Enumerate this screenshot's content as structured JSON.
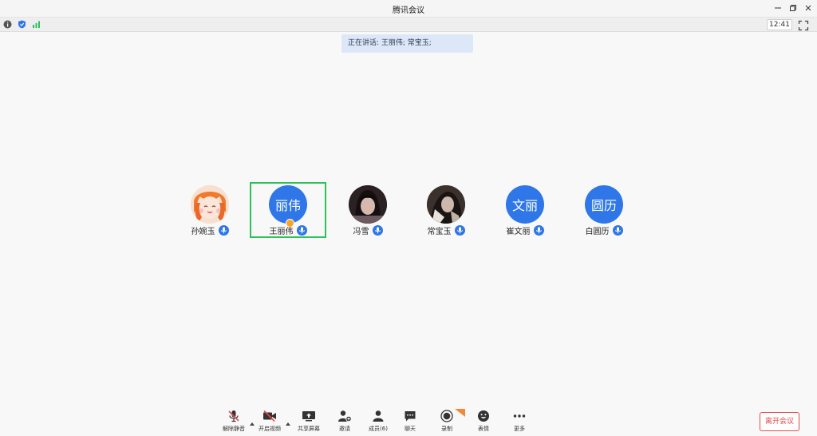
{
  "window": {
    "title": "腾讯会议"
  },
  "status_bar": {
    "clock": "12:41",
    "icons": [
      "info-icon",
      "shield-icon",
      "signal-icon"
    ]
  },
  "speaking_banner": {
    "text": "正在讲话: 王丽伟; 常宝玉;"
  },
  "participants": [
    {
      "name": "孙婉玉",
      "avatar_type": "photo",
      "avatar_text": "",
      "mic": "on"
    },
    {
      "name": "王丽伟",
      "avatar_type": "text",
      "avatar_text": "丽伟",
      "mic": "on",
      "active": true,
      "host": true
    },
    {
      "name": "冯雪",
      "avatar_type": "photo",
      "avatar_text": "",
      "mic": "on"
    },
    {
      "name": "常宝玉",
      "avatar_type": "photo",
      "avatar_text": "",
      "mic": "on"
    },
    {
      "name": "崔文丽",
      "avatar_type": "text",
      "avatar_text": "文丽",
      "mic": "on"
    },
    {
      "name": "白圆历",
      "avatar_type": "text",
      "avatar_text": "圆历",
      "mic": "on"
    }
  ],
  "toolbar": {
    "unmute": "解除静音",
    "start_video": "开启视频",
    "share_screen": "共享屏幕",
    "invite": "邀请",
    "members": "成员(6)",
    "chat": "聊天",
    "record": "录制",
    "reactions": "表情",
    "more": "更多",
    "leave": "离开会议"
  },
  "colors": {
    "accent": "#2f76e8",
    "active_border": "#2fc05a",
    "leave": "#e24b4b",
    "banner_bg": "#dce8f8"
  }
}
